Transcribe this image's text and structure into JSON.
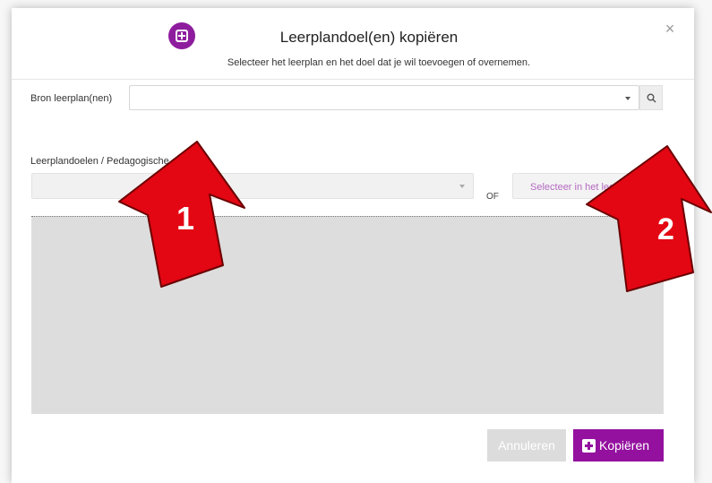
{
  "dialog": {
    "title": "Leerplandoel(en) kopiëren",
    "subtitle": "Selecteer het leerplan en het doel dat je wil toevoegen of overnemen.",
    "close_glyph": "×",
    "header_icon": "plus-square-icon"
  },
  "source": {
    "label": "Bron leerplan(nen)",
    "value": "",
    "search_icon": "search-icon"
  },
  "goals": {
    "label": "Leerplandoelen / Pedagogische denken",
    "value": "",
    "or_text": "OF",
    "select_in_button": "Selecteer in het leerplan"
  },
  "annotations": {
    "arrow_1": "1",
    "arrow_2": "2",
    "arrow_color": "#e30613"
  },
  "footer": {
    "cancel_label": "Annuleren",
    "copy_label": "Kopiëren",
    "copy_icon": "plus-square-icon"
  },
  "colors": {
    "accent": "#94119f",
    "content_bg": "#dddddd"
  }
}
